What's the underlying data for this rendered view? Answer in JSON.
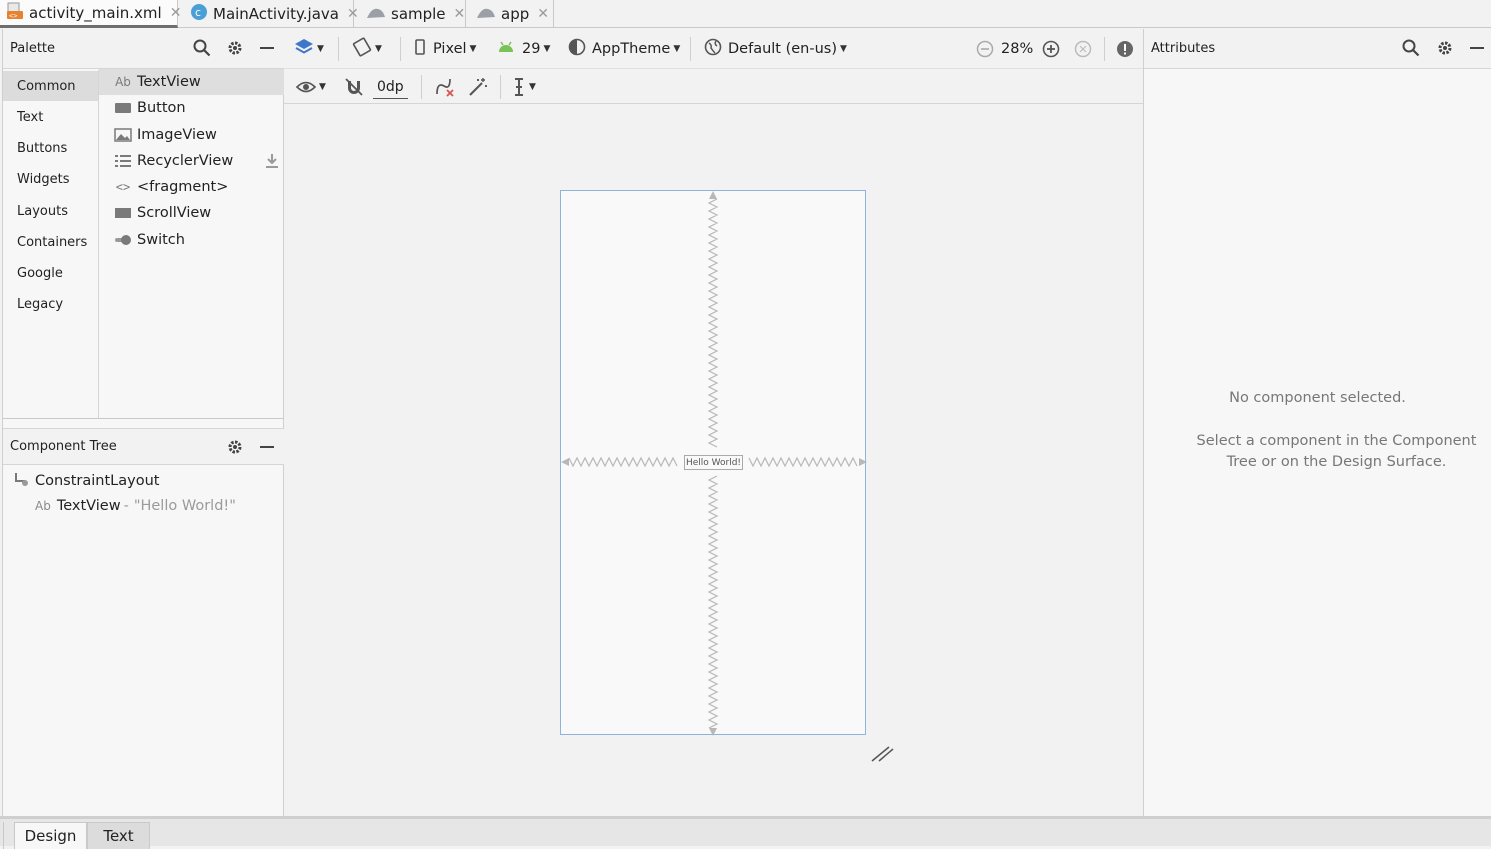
{
  "tabs": [
    {
      "label": "activity_main.xml",
      "icon": "xml-file-icon",
      "active": true
    },
    {
      "label": "MainActivity.java",
      "icon": "java-class-icon",
      "active": false
    },
    {
      "label": "sample",
      "icon": "android-module-icon",
      "active": false
    },
    {
      "label": "app",
      "icon": "android-module-icon",
      "active": false
    }
  ],
  "palette": {
    "title": "Palette",
    "categories": [
      "Common",
      "Text",
      "Buttons",
      "Widgets",
      "Layouts",
      "Containers",
      "Google",
      "Legacy"
    ],
    "items": [
      {
        "label": "TextView",
        "icon": "Ab"
      },
      {
        "label": "Button",
        "icon": "button-icon"
      },
      {
        "label": "ImageView",
        "icon": "image-icon"
      },
      {
        "label": "RecyclerView",
        "icon": "list-icon"
      },
      {
        "label": "<fragment>",
        "icon": "<>"
      },
      {
        "label": "ScrollView",
        "icon": "scrollview-icon"
      },
      {
        "label": "Switch",
        "icon": "switch-icon"
      }
    ]
  },
  "component_tree": {
    "title": "Component Tree",
    "root": "ConstraintLayout",
    "child_name": "TextView",
    "child_sep": "-",
    "child_text": "\"Hello World!\"",
    "child_icon": "Ab"
  },
  "toolbar": {
    "device": "Pixel",
    "api": "29",
    "theme": "AppTheme",
    "locale": "Default (en-us)",
    "zoom": "28%",
    "margin": "0dp"
  },
  "canvas": {
    "hello": "Hello World!"
  },
  "attributes": {
    "title": "Attributes",
    "empty_title": "No component selected.",
    "empty_line1": "Select a component in the Component",
    "empty_line2": "Tree or on the Design Surface."
  },
  "bottom_tabs": {
    "design": "Design",
    "text": "Text"
  },
  "colors": {
    "accent": "#3b78c9",
    "android_green": "#78c257",
    "canvas_border": "#8fb3dc"
  }
}
